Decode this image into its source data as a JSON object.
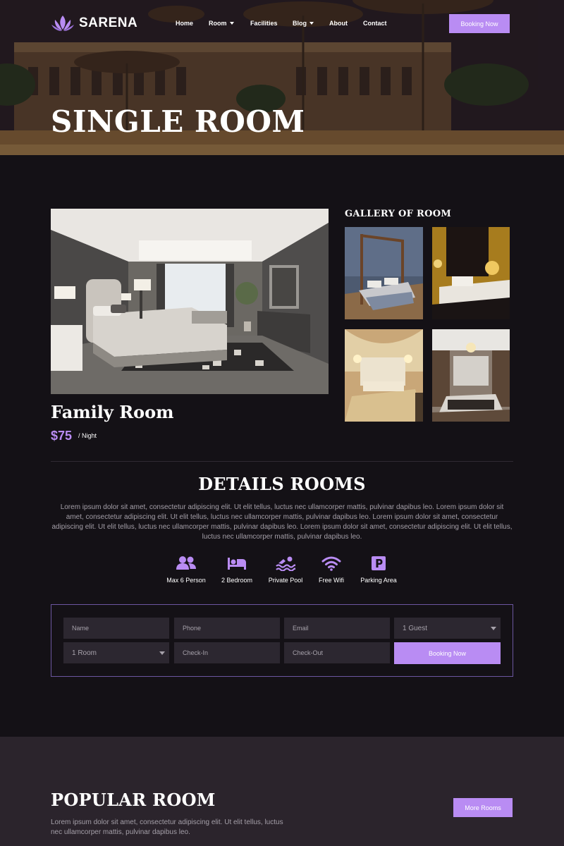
{
  "brand": {
    "name": "SARENA"
  },
  "nav": {
    "items": [
      {
        "label": "Home",
        "has_dropdown": false
      },
      {
        "label": "Room",
        "has_dropdown": true
      },
      {
        "label": "Facilities",
        "has_dropdown": false
      },
      {
        "label": "Blog",
        "has_dropdown": true
      },
      {
        "label": "About",
        "has_dropdown": false
      },
      {
        "label": "Contact",
        "has_dropdown": false
      }
    ],
    "cta_label": "Booking Now"
  },
  "hero": {
    "title": "SINGLE ROOM"
  },
  "room": {
    "name": "Family Room",
    "price": "$75",
    "per": "/ Night"
  },
  "gallery": {
    "title": "GALLERY OF ROOM"
  },
  "details": {
    "title": "DETAILS ROOMS",
    "text": "Lorem ipsum dolor sit amet, consectetur adipiscing elit. Ut elit tellus, luctus nec ullamcorper mattis, pulvinar dapibus leo. Lorem ipsum dolor sit amet, consectetur adipiscing elit. Ut elit tellus, luctus nec ullamcorper mattis, pulvinar dapibus leo. Lorem ipsum dolor sit amet, consectetur adipiscing elit. Ut elit tellus, luctus nec ullamcorper mattis, pulvinar dapibus leo. Lorem ipsum dolor sit amet, consectetur adipiscing elit. Ut elit tellus, luctus nec ullamcorper mattis, pulvinar dapibus leo.",
    "amenities": [
      {
        "label": "Max 6 Person",
        "icon": "users-icon"
      },
      {
        "label": "2 Bedroom",
        "icon": "bed-icon"
      },
      {
        "label": "Private Pool",
        "icon": "pool-icon"
      },
      {
        "label": "Free Wifi",
        "icon": "wifi-icon"
      },
      {
        "label": "Parking Area",
        "icon": "parking-icon"
      }
    ]
  },
  "booking_form": {
    "name_placeholder": "Name",
    "phone_placeholder": "Phone",
    "email_placeholder": "Email",
    "guests_value": "1 Guest",
    "rooms_value": "1 Room",
    "checkin_placeholder": "Check-In",
    "checkout_placeholder": "Check-Out",
    "submit_label": "Booking Now"
  },
  "popular": {
    "title": "POPULAR ROOM",
    "text": "Lorem ipsum dolor sit amet, consectetur adipiscing elit. Ut elit tellus, luctus nec ullamcorper mattis, pulvinar dapibus leo.",
    "more_label": "More Rooms"
  },
  "colors": {
    "accent": "#b98cf3",
    "background": "#141116",
    "section_alt": "#2b242c",
    "field": "#2c2730"
  }
}
